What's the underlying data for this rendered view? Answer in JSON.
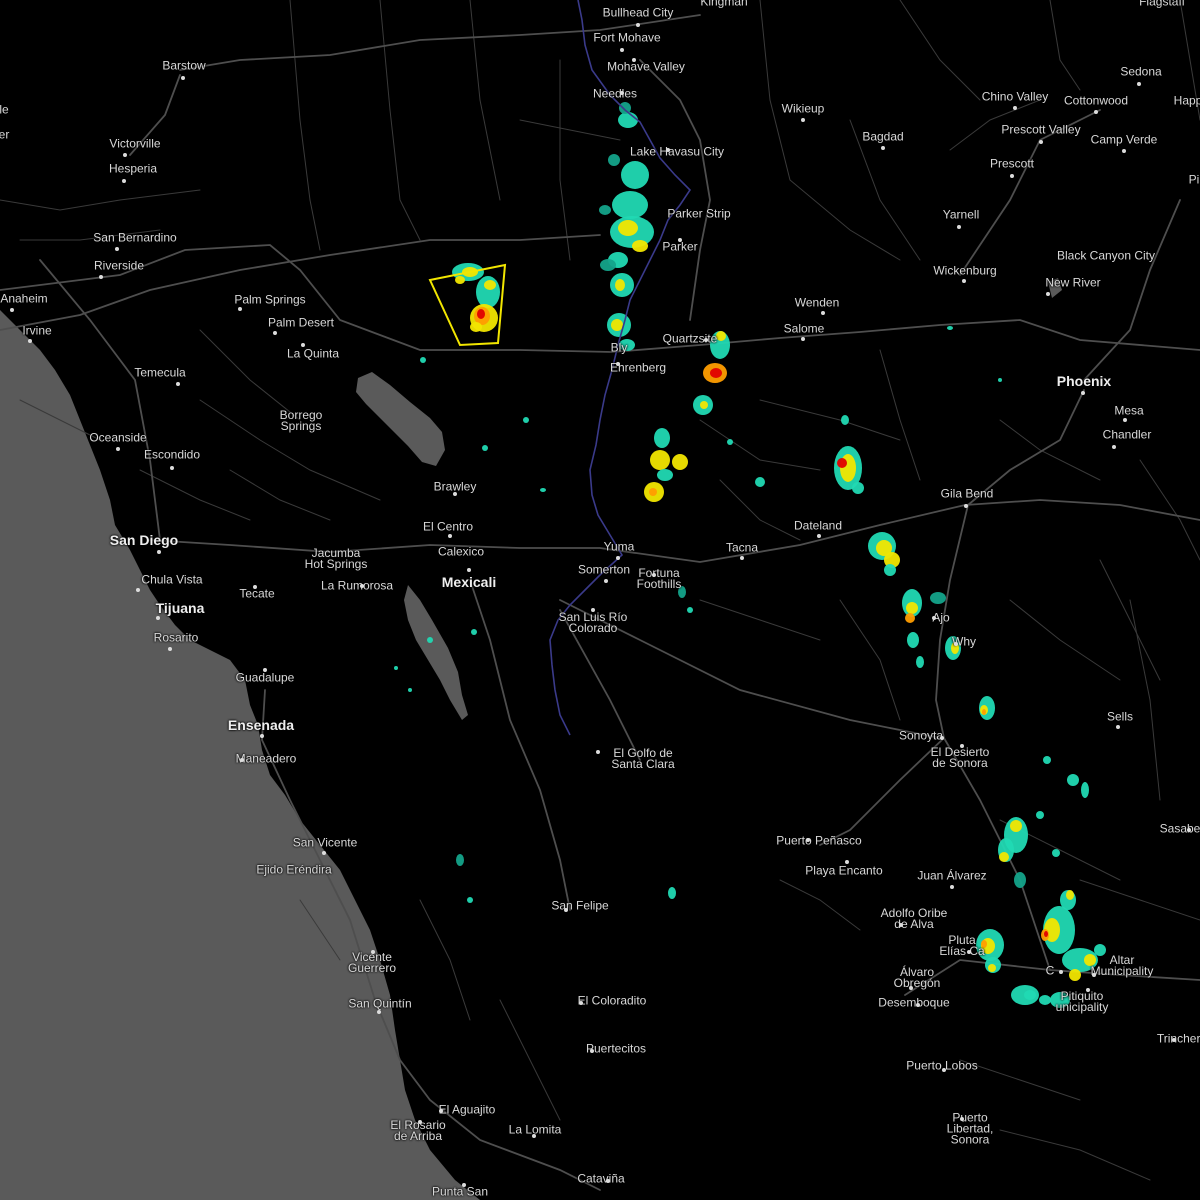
{
  "map": {
    "colors": {
      "land": "#000000",
      "water": "#5a5a5a",
      "roads": "#3a3a3a",
      "highways": "#4e4e4e",
      "river": "#3a3a8a",
      "warning_outline": "#f2e600",
      "labels": "#d8d8d8"
    },
    "radar_legend_colors": [
      "#14a38a",
      "#21d9b3",
      "#f2e600",
      "#ff9d00",
      "#e00000",
      "#a00000"
    ],
    "places": [
      {
        "id": "bullhead-city",
        "name": "Bullhead City"
      },
      {
        "id": "kingman",
        "name": "Kingman"
      },
      {
        "id": "flagstaff",
        "name": "Flagstaff"
      },
      {
        "id": "fort-mohave",
        "name": "Fort Mohave"
      },
      {
        "id": "mohave-valley",
        "name": "Mohave Valley"
      },
      {
        "id": "needles",
        "name": "Needles"
      },
      {
        "id": "barstow",
        "name": "Barstow"
      },
      {
        "id": "sedona",
        "name": "Sedona"
      },
      {
        "id": "chino-valley",
        "name": "Chino Valley"
      },
      {
        "id": "cottonwood",
        "name": "Cottonwood"
      },
      {
        "id": "wikieup",
        "name": "Wikieup"
      },
      {
        "id": "lake-havasu-city",
        "name": "Lake Havasu City"
      },
      {
        "id": "bagdad",
        "name": "Bagdad"
      },
      {
        "id": "prescott-valley",
        "name": "Prescott Valley"
      },
      {
        "id": "camp-verde",
        "name": "Camp Verde"
      },
      {
        "id": "victorville",
        "name": "Victorville"
      },
      {
        "id": "hesperia",
        "name": "Hesperia"
      },
      {
        "id": "prescott",
        "name": "Prescott"
      },
      {
        "id": "parker-strip",
        "name": "Parker Strip"
      },
      {
        "id": "yarnell",
        "name": "Yarnell"
      },
      {
        "id": "san-bernardino",
        "name": "San Bernardino"
      },
      {
        "id": "parker",
        "name": "Parker"
      },
      {
        "id": "black-canyon-city",
        "name": "Black Canyon City"
      },
      {
        "id": "riverside",
        "name": "Riverside"
      },
      {
        "id": "wickenburg",
        "name": "Wickenburg"
      },
      {
        "id": "new-river",
        "name": "New River"
      },
      {
        "id": "anaheim",
        "name": "Anaheim"
      },
      {
        "id": "palm-springs",
        "name": "Palm Springs"
      },
      {
        "id": "wenden",
        "name": "Wenden"
      },
      {
        "id": "irvine",
        "name": "Irvine"
      },
      {
        "id": "palm-desert",
        "name": "Palm Desert"
      },
      {
        "id": "salome",
        "name": "Salome"
      },
      {
        "id": "quartzsite",
        "name": "Quartzsite"
      },
      {
        "id": "la-quinta",
        "name": "La Quinta"
      },
      {
        "id": "blythe",
        "name": "Bly"
      },
      {
        "id": "ehrenberg",
        "name": "Ehrenberg"
      },
      {
        "id": "temecula",
        "name": "Temecula"
      },
      {
        "id": "phoenix",
        "name": "Phoenix"
      },
      {
        "id": "mesa",
        "name": "Mesa"
      },
      {
        "id": "borrego-springs",
        "name": "Borrego\nSprings"
      },
      {
        "id": "chandler",
        "name": "Chandler"
      },
      {
        "id": "oceanside",
        "name": "Oceanside"
      },
      {
        "id": "escondido",
        "name": "Escondido"
      },
      {
        "id": "brawley",
        "name": "Brawley"
      },
      {
        "id": "gila-bend",
        "name": "Gila Bend"
      },
      {
        "id": "el-centro",
        "name": "El Centro"
      },
      {
        "id": "dateland",
        "name": "Dateland"
      },
      {
        "id": "san-diego",
        "name": "San Diego"
      },
      {
        "id": "yuma",
        "name": "Yuma"
      },
      {
        "id": "tacna",
        "name": "Tacna"
      },
      {
        "id": "calexico",
        "name": "Calexico"
      },
      {
        "id": "jacumba",
        "name": "Jacumba\nHot Springs"
      },
      {
        "id": "somerton",
        "name": "Somerton"
      },
      {
        "id": "fortuna-foothills",
        "name": "Fortuna\nFoothills"
      },
      {
        "id": "chula-vista",
        "name": "Chula Vista"
      },
      {
        "id": "mexicali",
        "name": "Mexicali"
      },
      {
        "id": "la-rumorosa",
        "name": "La Rumorosa"
      },
      {
        "id": "tecate",
        "name": "Tecate"
      },
      {
        "id": "tijuana",
        "name": "Tijuana"
      },
      {
        "id": "san-luis-rio-colorado",
        "name": "San Luis Río\nColorado"
      },
      {
        "id": "ajo",
        "name": "Ajo"
      },
      {
        "id": "why",
        "name": "Why"
      },
      {
        "id": "rosarito",
        "name": "Rosarito"
      },
      {
        "id": "guadalupe",
        "name": "Guadalupe"
      },
      {
        "id": "sells",
        "name": "Sells"
      },
      {
        "id": "ensenada",
        "name": "Ensenada"
      },
      {
        "id": "sonoyta",
        "name": "Sonoyta"
      },
      {
        "id": "el-desierto-de-sonora",
        "name": "El Desierto\nde Sonora"
      },
      {
        "id": "maneadero",
        "name": "Maneadero"
      },
      {
        "id": "el-golfo-de-santa-clara",
        "name": "El Golfo de\nSanta Clara"
      },
      {
        "id": "sasabe",
        "name": "Sasabe"
      },
      {
        "id": "puerto-penasco",
        "name": "Puerto Peñasco"
      },
      {
        "id": "san-vicente",
        "name": "San Vicente"
      },
      {
        "id": "playa-encanto",
        "name": "Playa Encanto"
      },
      {
        "id": "ejido-erendira",
        "name": "Ejido Eréndira"
      },
      {
        "id": "juan-alvarez",
        "name": "Juan Álvarez"
      },
      {
        "id": "san-felipe",
        "name": "San Felipe"
      },
      {
        "id": "adolfo-oribe-de-alva",
        "name": "Adolfo Oribe\nde Alva"
      },
      {
        "id": "plutarco-elias-calles",
        "name": "Pluta\nElías Ca"
      },
      {
        "id": "altar-municipality",
        "name": "Altar\nMunicipality"
      },
      {
        "id": "vicente-guerrero",
        "name": "Vicente\nGuerrero"
      },
      {
        "id": "caborca",
        "name": "C"
      },
      {
        "id": "alvaro-obregon",
        "name": "Álvaro\nObregón"
      },
      {
        "id": "pitiquito",
        "name": "Pitiquito\nunicipality"
      },
      {
        "id": "desemboque",
        "name": "Desemboque"
      },
      {
        "id": "el-coloradito",
        "name": "El Coloradito"
      },
      {
        "id": "san-quintin",
        "name": "San Quintín"
      },
      {
        "id": "trincheras",
        "name": "Trinchera"
      },
      {
        "id": "puertecitos",
        "name": "Puertecitos"
      },
      {
        "id": "puerto-lobos",
        "name": "Puerto Lobos"
      },
      {
        "id": "el-aguajito",
        "name": "El Aguajito"
      },
      {
        "id": "puerto-libertad",
        "name": "Puerto\nLibertad,\nSonora"
      },
      {
        "id": "el-rosario-de-arriba",
        "name": "El Rosario\nde Arriba"
      },
      {
        "id": "la-lomita",
        "name": "La Lomita"
      },
      {
        "id": "catavina",
        "name": "Cataviña"
      },
      {
        "id": "punta-san",
        "name": "Punta San"
      },
      {
        "id": "edge-le",
        "name": "le"
      },
      {
        "id": "edge-er",
        "name": "er"
      },
      {
        "id": "edge-happ",
        "name": "Happ"
      },
      {
        "id": "edge-pi",
        "name": "Pi"
      }
    ],
    "warning_polygon": {
      "type": "Severe Thunderstorm Warning"
    }
  }
}
